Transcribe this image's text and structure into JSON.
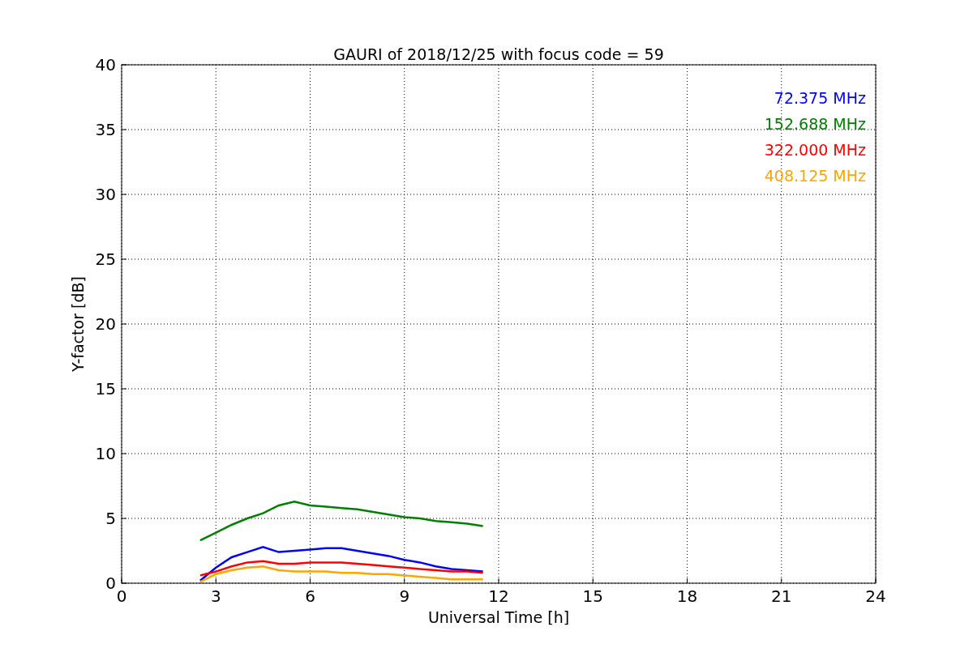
{
  "chart_data": {
    "type": "line",
    "title": "GAURI of 2018/12/25 with focus code = 59",
    "xlabel": "Universal Time [h]",
    "ylabel": "Y-factor [dB]",
    "x": [
      2.5,
      3,
      3.5,
      4,
      4.5,
      5,
      5.5,
      6,
      6.5,
      7,
      7.5,
      8,
      8.5,
      9,
      9.5,
      10,
      10.5,
      11,
      11.5
    ],
    "series": [
      {
        "name": "72.375 MHz",
        "color": "#0000ff",
        "values": [
          0.2,
          1.2,
          2.0,
          2.4,
          2.8,
          2.4,
          2.5,
          2.6,
          2.7,
          2.7,
          2.5,
          2.3,
          2.1,
          1.8,
          1.6,
          1.3,
          1.1,
          1.0,
          0.9
        ]
      },
      {
        "name": "152.688 MHz",
        "color": "#008000",
        "values": [
          3.3,
          3.9,
          4.5,
          5.0,
          5.4,
          6.0,
          6.3,
          6.0,
          5.9,
          5.8,
          5.7,
          5.5,
          5.3,
          5.1,
          5.0,
          4.8,
          4.7,
          4.6,
          4.4
        ]
      },
      {
        "name": "322.000 MHz",
        "color": "#ff0000",
        "values": [
          0.6,
          0.9,
          1.3,
          1.6,
          1.7,
          1.5,
          1.5,
          1.6,
          1.6,
          1.6,
          1.5,
          1.4,
          1.3,
          1.2,
          1.1,
          1.0,
          0.9,
          0.9,
          0.8
        ]
      },
      {
        "name": "408.125 MHz",
        "color": "#ffa500",
        "values": [
          0.1,
          0.7,
          1.0,
          1.2,
          1.3,
          1.0,
          0.9,
          0.9,
          0.9,
          0.8,
          0.8,
          0.7,
          0.7,
          0.6,
          0.5,
          0.4,
          0.3,
          0.3,
          0.3
        ]
      }
    ],
    "grid": true,
    "xlim": [
      0,
      24
    ],
    "ylim": [
      0,
      40
    ],
    "xticks": [
      0,
      3,
      6,
      9,
      12,
      15,
      18,
      21,
      24
    ],
    "yticks": [
      0,
      5,
      10,
      15,
      20,
      25,
      30,
      35,
      40
    ]
  }
}
